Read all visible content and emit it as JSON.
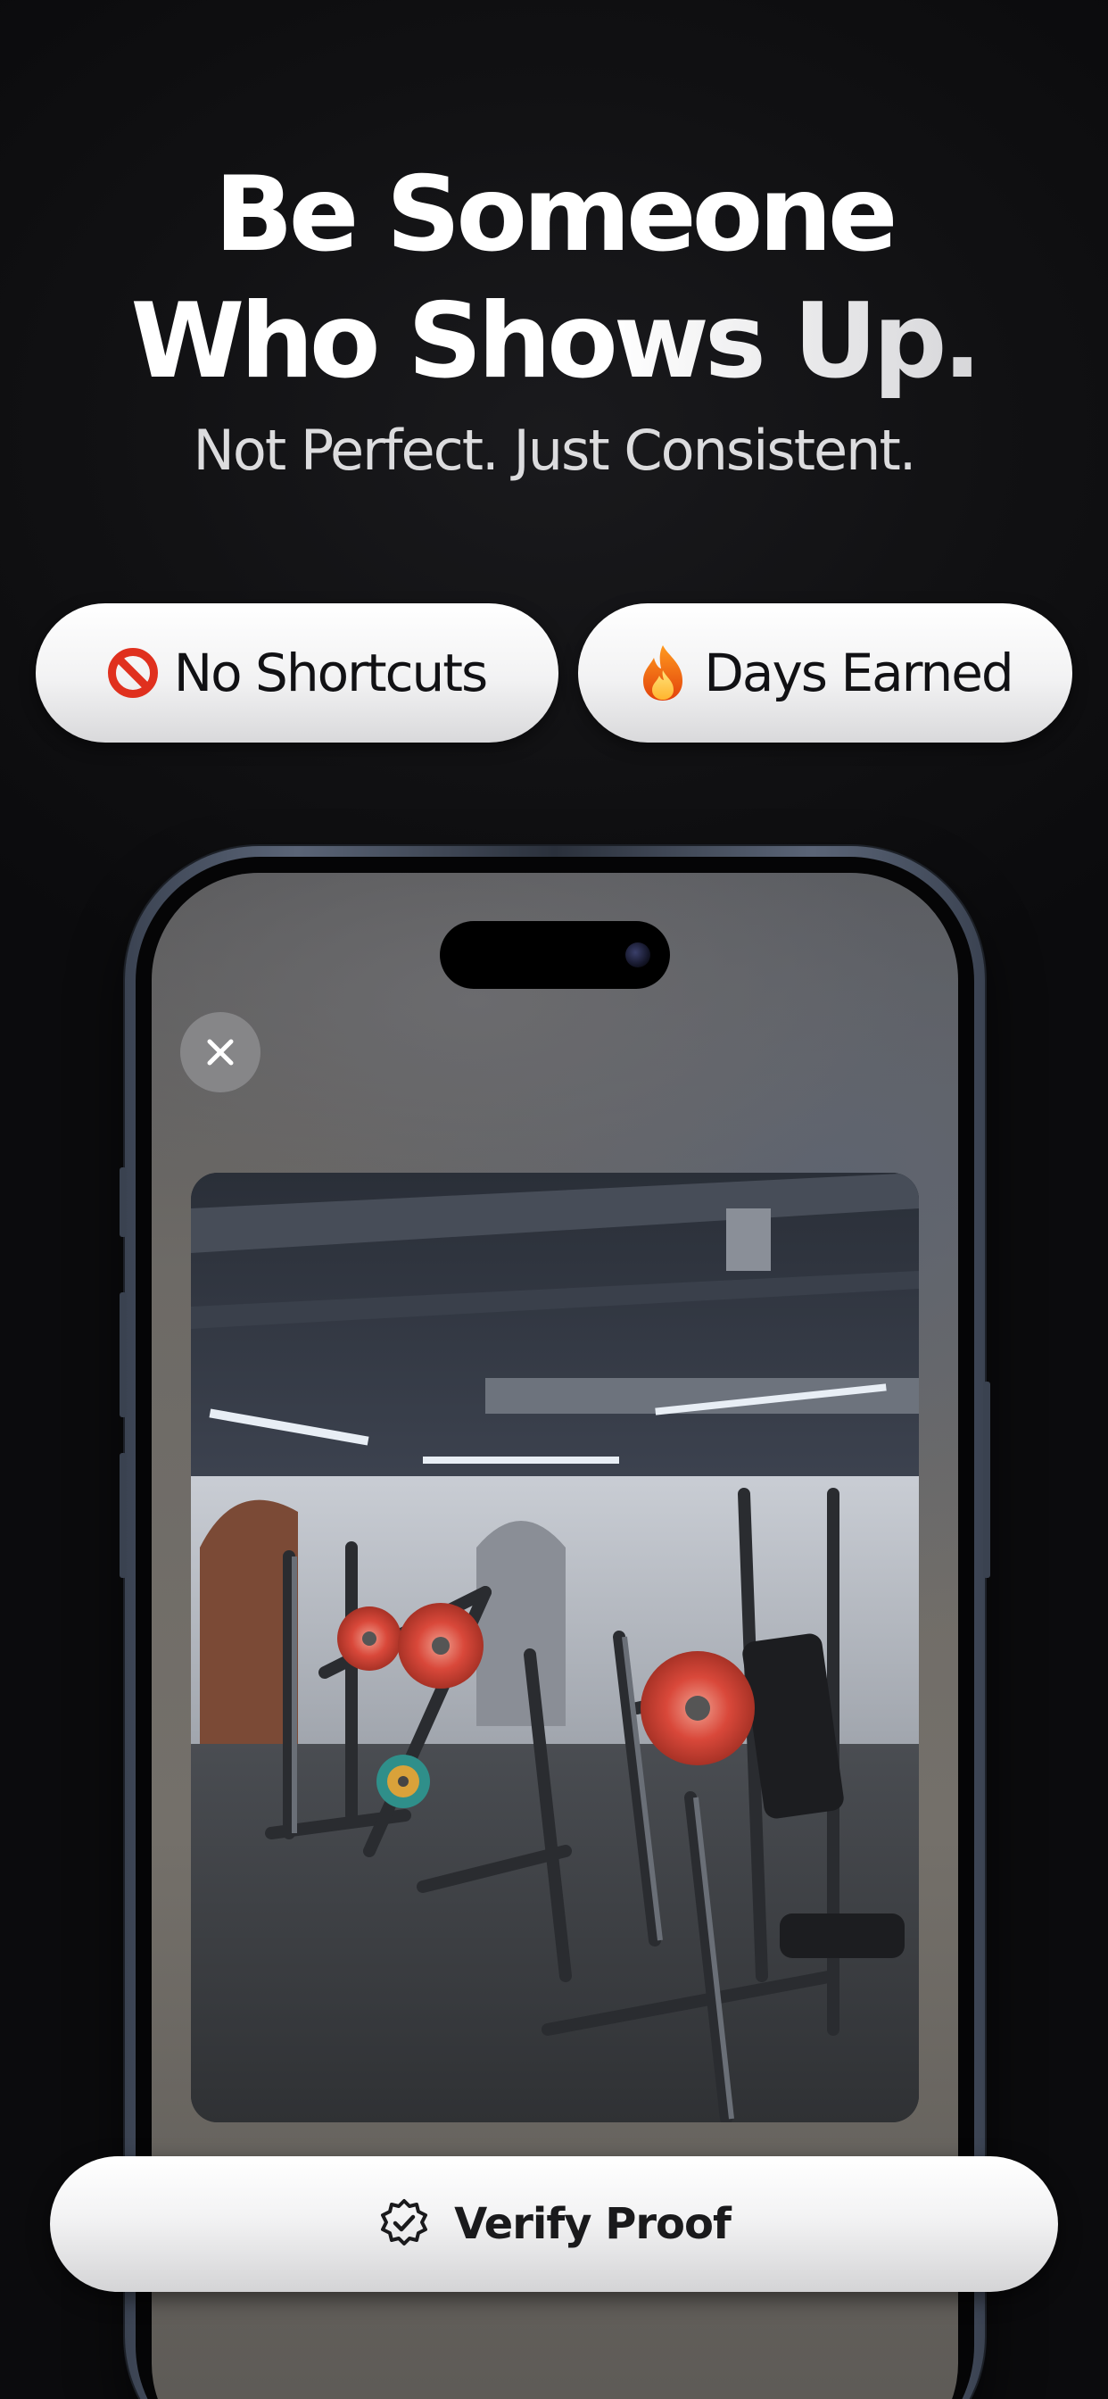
{
  "headline": {
    "line1": "Be Someone",
    "line2": "Who Shows Up.",
    "subtitle": "Not Perfect. Just Consistent."
  },
  "pills": [
    {
      "icon": "no-entry-icon",
      "label": "No Shortcuts"
    },
    {
      "icon": "fire-icon",
      "label": "Days Earned"
    }
  ],
  "phone": {
    "close_icon": "close-icon",
    "photo_subject": "gym-photo"
  },
  "cta": {
    "icon": "verified-badge-icon",
    "label": "Verify Proof"
  },
  "colors": {
    "background": "#0e0e10",
    "pill_fill": "#f2f2f3",
    "text_dark": "#111114",
    "no_entry_red": "#e0301e",
    "fire_orange": "#f5700a",
    "plate_red": "#d9483a"
  }
}
